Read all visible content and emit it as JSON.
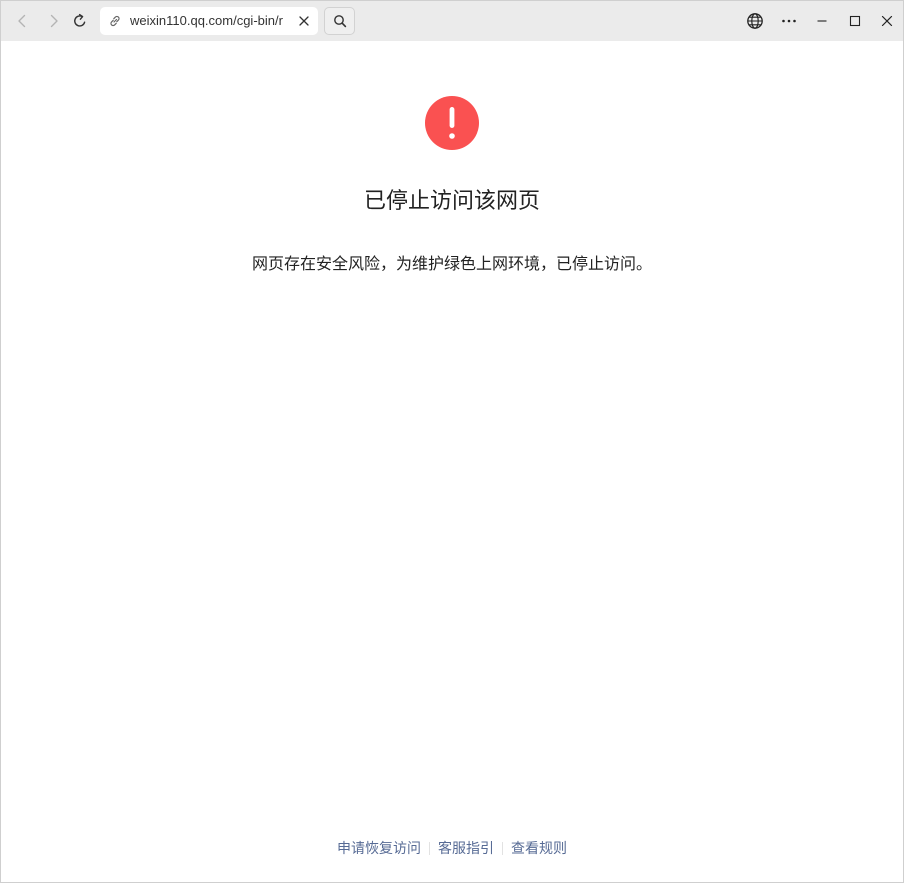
{
  "browser": {
    "url": "weixin110.qq.com/cgi-bin/r",
    "icons": {
      "back": "back-arrow-icon",
      "forward": "forward-arrow-icon",
      "reload": "reload-icon",
      "link": "link-icon",
      "clear": "close-icon",
      "search": "search-icon",
      "globe": "globe-icon",
      "more": "more-dots-icon",
      "minimize": "minimize-icon",
      "maximize": "maximize-icon",
      "close": "window-close-icon"
    }
  },
  "page": {
    "title": "已停止访问该网页",
    "description": "网页存在安全风险，为维护绿色上网环境，已停止访问。",
    "warning_color": "#fa5151",
    "footer": {
      "links": [
        "申请恢复访问",
        "客服指引",
        "查看规则"
      ],
      "link_color": "#576b95"
    }
  }
}
